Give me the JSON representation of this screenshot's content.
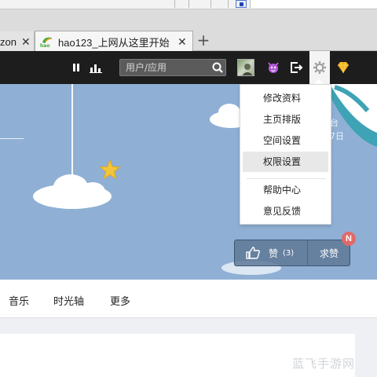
{
  "browser": {
    "tabs": [
      {
        "label": "zon",
        "active": false
      },
      {
        "label": "hao123_上网从这里开始",
        "active": true
      }
    ],
    "favicon_text": "hao",
    "close_glyph": "✕",
    "new_tab_glyph": "+"
  },
  "toolbar": {
    "search_placeholder": "用户/应用",
    "icons": [
      "pause-icon",
      "stats-icon",
      "search-icon",
      "avatar",
      "devil-icon",
      "logout-icon",
      "gear-icon",
      "diamond-icon"
    ]
  },
  "dropdown": {
    "items": [
      "修改资料",
      "主页排版",
      "空间设置",
      "权限设置"
    ],
    "items2": [
      "帮助中心",
      "意见反馈"
    ],
    "active_index": 3
  },
  "cover": {
    "right_text_1": "台",
    "right_text_2": "7日"
  },
  "praise": {
    "like_label": "赞",
    "like_count": "(3)",
    "ask_label": "求赞",
    "badge": "N"
  },
  "nav": {
    "items": [
      "音乐",
      "时光轴",
      "更多"
    ]
  },
  "watermark": "蓝飞手游网",
  "colors": {
    "sitebar": "#1d1d1d",
    "cover": "#8fb0d4",
    "badge": "#e06a6a",
    "star": "#f2c53d"
  }
}
